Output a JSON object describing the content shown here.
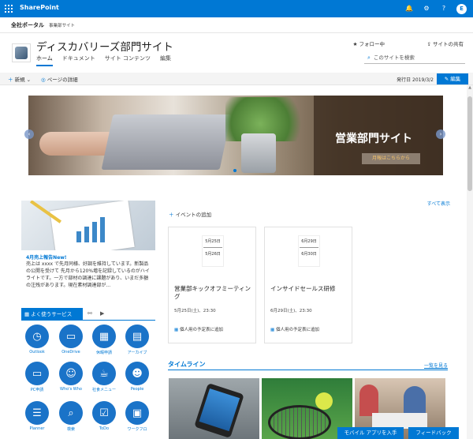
{
  "suite": {
    "brand": "SharePoint",
    "icons": [
      "bell-icon",
      "gear-icon",
      "help-icon"
    ],
    "user_initial": "E",
    "accent": "#0078d4"
  },
  "hub": {
    "title": "全社ポータル",
    "link": "事業部サイト"
  },
  "site": {
    "title": "ディスカバリーズ部門サイト",
    "nav": [
      "ホーム",
      "ドキュメント",
      "サイト コンテンツ",
      "編集"
    ],
    "follow": "フォロー中",
    "share": "サイトの共有",
    "search_placeholder": "このサイトを検索"
  },
  "command": {
    "new": "新規",
    "page_details": "ページの詳細",
    "published": "発行日 2019/3/2",
    "edit": "編集"
  },
  "hero": {
    "title": "営業部門サイト",
    "button": "月報はこちらから"
  },
  "news": {
    "title": "4月売上報告New!",
    "body": "売上は xxxx で先月同様、好調を維持しています。新製品の公開を受けて 先月から120%増を記録しているのがハイライトです。一方で部材の調達に課題があり、いまだ多額の注残があります。現在素材調達部が..."
  },
  "quick_services": {
    "tab_active": "よく使うサービス",
    "tabs": [
      "share-icon",
      "video-icon"
    ],
    "items": [
      {
        "label": "Outlook",
        "icon": "clock-icon"
      },
      {
        "label": "OneDrive",
        "icon": "folder-icon"
      },
      {
        "label": "休暇申請",
        "icon": "calendar-icon"
      },
      {
        "label": "アーカイブ",
        "icon": "archive-icon"
      },
      {
        "label": "PC申請",
        "icon": "monitor-icon"
      },
      {
        "label": "Who's Who",
        "icon": "person-icon"
      },
      {
        "label": "社食メニュー",
        "icon": "coffee-icon"
      },
      {
        "label": "People",
        "icon": "people-icon"
      },
      {
        "label": "Planner",
        "icon": "list-icon"
      },
      {
        "label": "検索",
        "icon": "search-icon"
      },
      {
        "label": "ToDo",
        "icon": "checkbox-icon"
      },
      {
        "label": "ワークフロ",
        "icon": "workflow-icon"
      }
    ]
  },
  "events": {
    "see_all": "すべて表示",
    "add": "イベントの追加",
    "add_to_calendar": "個人用の予定表に追加",
    "items": [
      {
        "date_start": "5月25日",
        "date_end": "5月26日",
        "title": "営業部キックオフミーティング",
        "time": "5月25日(土)、23:30"
      },
      {
        "date_start": "6月29日",
        "date_end": "6月30日",
        "title": "インサイドセールス研修",
        "time": "6月29日(土)、23:30"
      }
    ]
  },
  "timeline": {
    "title": "タイムライン",
    "more": "一覧を見る"
  },
  "footer": {
    "mobile": "モバイル アプリを入手",
    "feedback": "フィードバック"
  }
}
